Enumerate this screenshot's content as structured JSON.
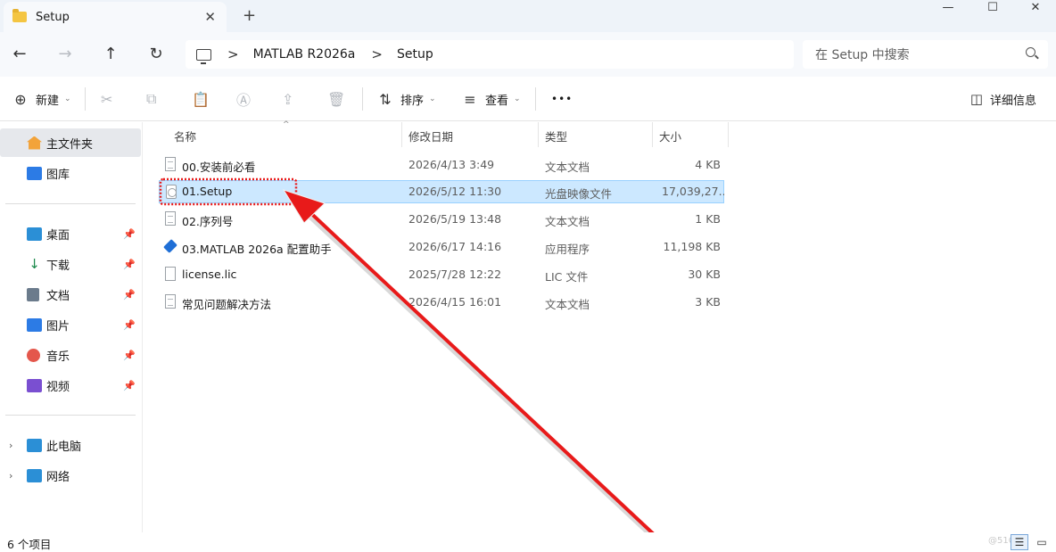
{
  "window": {
    "tab_title": "Setup",
    "tab_close": "✕",
    "new_tab": "+",
    "minimize": "—",
    "maximize": "☐",
    "close": "✕"
  },
  "nav": {
    "back": "←",
    "forward": "→",
    "up": "↑",
    "refresh": "↻",
    "separator": ">",
    "breadcrumb": [
      "MATLAB R2026a",
      "Setup"
    ],
    "search_placeholder": "在 Setup 中搜索"
  },
  "toolbar": {
    "new_label": "新建",
    "sort_label": "排序",
    "view_label": "查看",
    "more_label": "•••",
    "details_label": "详细信息"
  },
  "sidebar": {
    "quick": [
      {
        "label": "主文件夹",
        "icon": "home-icon",
        "color": "#f2a33a"
      },
      {
        "label": "图库",
        "icon": "gallery-icon",
        "color": "#2c7be5"
      }
    ],
    "pinned": [
      {
        "label": "桌面",
        "icon": "desktop-icon",
        "color": "#2b8fd6"
      },
      {
        "label": "下载",
        "icon": "download-icon",
        "color": "#1c8a4c"
      },
      {
        "label": "文档",
        "icon": "documents-icon",
        "color": "#6b7b8c"
      },
      {
        "label": "图片",
        "icon": "pictures-icon",
        "color": "#2c7be5"
      },
      {
        "label": "音乐",
        "icon": "music-icon",
        "color": "#e4574c"
      },
      {
        "label": "视频",
        "icon": "videos-icon",
        "color": "#7a4fd1"
      }
    ],
    "devices": [
      {
        "label": "此电脑",
        "icon": "this-pc-icon",
        "color": "#2b8fd6"
      },
      {
        "label": "网络",
        "icon": "network-icon",
        "color": "#2b8fd6"
      }
    ],
    "pin_glyph": "📌",
    "expander_glyph": "›"
  },
  "columns": {
    "name": "名称",
    "modified": "修改日期",
    "type": "类型",
    "size": "大小"
  },
  "files": [
    {
      "name": "00.安装前必看",
      "modified": "2026/4/13 3:49",
      "type": "文本文档",
      "size": "4 KB",
      "icon": "text-file-icon"
    },
    {
      "name": "01.Setup",
      "modified": "2026/5/12 11:30",
      "type": "光盘映像文件",
      "size": "17,039,27...",
      "icon": "disc-image-icon"
    },
    {
      "name": "02.序列号",
      "modified": "2026/5/19 13:48",
      "type": "文本文档",
      "size": "1 KB",
      "icon": "text-file-icon"
    },
    {
      "name": "03.MATLAB 2026a 配置助手",
      "modified": "2026/6/17 14:16",
      "type": "应用程序",
      "size": "11,198 KB",
      "icon": "application-icon"
    },
    {
      "name": "license.lic",
      "modified": "2025/7/28 12:22",
      "type": "LIC 文件",
      "size": "30 KB",
      "icon": "file-icon"
    },
    {
      "name": "常见问题解决方法",
      "modified": "2026/4/15 16:01",
      "type": "文本文档",
      "size": "3 KB",
      "icon": "text-file-icon"
    }
  ],
  "status": {
    "count": "6 个项目",
    "watermark": "@51CTO"
  },
  "colors": {
    "selection_fill": "#cce8ff",
    "annotation_red": "#e81a1a"
  }
}
